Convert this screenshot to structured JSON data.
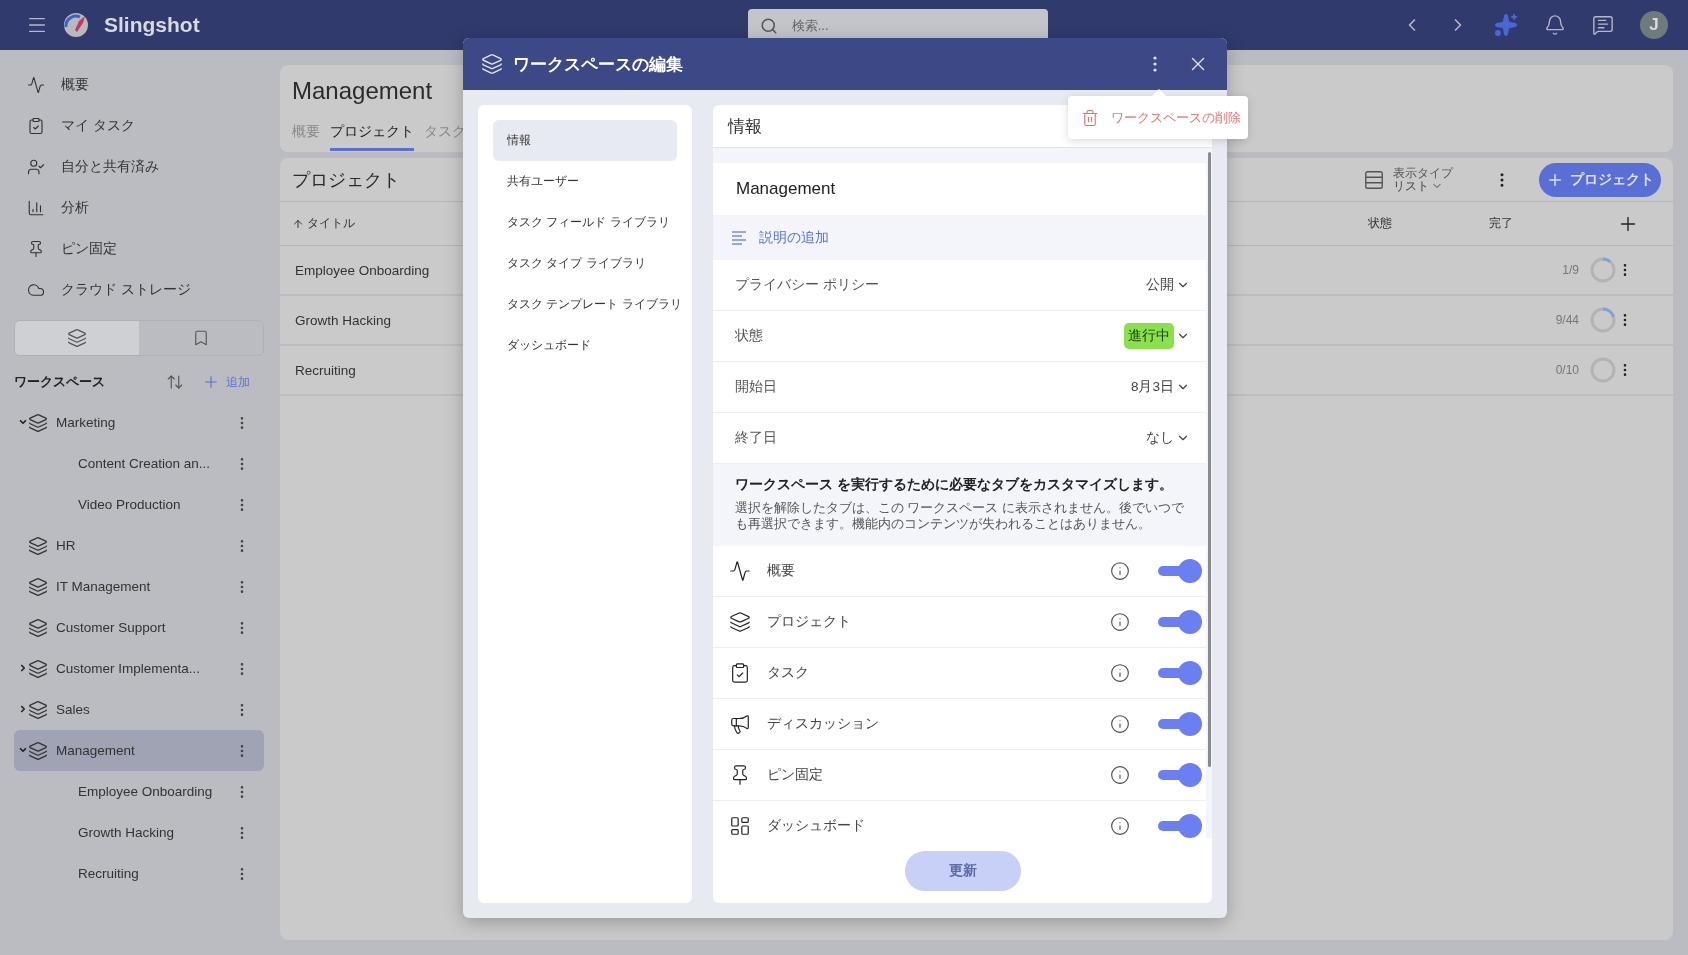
{
  "topbar": {
    "brand": "Slingshot",
    "search": {
      "placeholder": "検索..."
    },
    "avatar": "J"
  },
  "sidebar": {
    "nav": [
      {
        "label": "概要"
      },
      {
        "label": "マイ タスク"
      },
      {
        "label": "自分と共有済み"
      },
      {
        "label": "分析"
      },
      {
        "label": "ピン固定"
      },
      {
        "label": "クラウド ストレージ"
      }
    ],
    "view_tabs": [
      {
        "selected": true
      },
      {
        "selected": false
      }
    ],
    "workspaces_title": "ワークスペース",
    "add_label": "追加",
    "tree": [
      {
        "label": "Marketing",
        "expanded": true,
        "selected": false,
        "children": [
          {
            "label": "Content Creation an...",
            "selected": false
          },
          {
            "label": "Video Production",
            "selected": false
          }
        ]
      },
      {
        "label": "HR",
        "selected": false
      },
      {
        "label": "IT Management",
        "selected": false
      },
      {
        "label": "Customer Support",
        "selected": false
      },
      {
        "label": "Customer Implementa...",
        "expanded": false,
        "selected": false
      },
      {
        "label": "Sales",
        "expanded": false,
        "selected": false
      },
      {
        "label": "Management",
        "expanded": true,
        "selected": true,
        "children": [
          {
            "label": "Employee Onboarding",
            "selected": false
          },
          {
            "label": "Growth Hacking",
            "selected": false
          },
          {
            "label": "Recruiting",
            "selected": false
          }
        ]
      }
    ]
  },
  "main": {
    "title": "Management",
    "tabs": [
      {
        "label": "概要",
        "selected": false
      },
      {
        "label": "プロジェクト",
        "selected": true
      },
      {
        "label": "タスク",
        "selected": false
      }
    ],
    "section_title": "プロジェクト",
    "view_type": {
      "label": "表示タイプ",
      "value": "リスト"
    },
    "add_button": "プロジェクト",
    "columns": [
      {
        "label": "タイトル",
        "sorted": true
      },
      {
        "label": "状態",
        "sorted": false
      },
      {
        "label": "完了",
        "sorted": false
      }
    ],
    "rows": [
      {
        "title": "Employee Onboarding",
        "progress": "1/9",
        "level": 0.11
      },
      {
        "title": "Growth Hacking",
        "progress": "9/44",
        "level": 0.2
      },
      {
        "title": "Recruiting",
        "progress": "0/10",
        "level": 0
      }
    ]
  },
  "modal": {
    "title": "ワークスペースの編集",
    "menu_item": "ワークスペースの削除",
    "nav": [
      {
        "label": "情報",
        "selected": true
      },
      {
        "label": "共有ユーザー",
        "selected": false
      },
      {
        "label": "タスク フィールド ライブラリ",
        "selected": false
      },
      {
        "label": "タスク タイプ ライブラリ",
        "selected": false
      },
      {
        "label": "タスク テンプレート ライブラリ",
        "selected": false
      },
      {
        "label": "ダッシュボード",
        "selected": false
      }
    ],
    "panel_title": "情報",
    "name": "Management",
    "add_description": "説明の追加",
    "fields": [
      {
        "label": "プライバシー ポリシー",
        "value": "公開",
        "kind": "text"
      },
      {
        "label": "状態",
        "value": "進行中",
        "kind": "badge"
      },
      {
        "label": "開始日",
        "value": "8月3日",
        "kind": "text"
      },
      {
        "label": "終了日",
        "value": "なし",
        "kind": "text"
      }
    ],
    "customize": {
      "heading": "ワークスペース を実行するために必要なタブをカスタマイズします。",
      "body": "選択を解除したタブは、この ワークスペース に表示されません。後でいつでも再選択できます。機能内のコンテンツが失われることはありません。"
    },
    "features": [
      {
        "label": "概要",
        "on": true
      },
      {
        "label": "プロジェクト",
        "on": true
      },
      {
        "label": "タスク",
        "on": true
      },
      {
        "label": "ディスカッション",
        "on": true
      },
      {
        "label": "ピン固定",
        "on": true
      },
      {
        "label": "ダッシュボード",
        "on": true
      }
    ],
    "submit": {
      "label": "更新",
      "disabled": true
    }
  }
}
